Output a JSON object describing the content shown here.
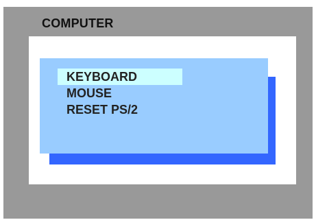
{
  "screen": {
    "title": "COMPUTER"
  },
  "menu": {
    "items": [
      {
        "label": "KEYBOARD",
        "selected": true
      },
      {
        "label": "MOUSE",
        "selected": false
      },
      {
        "label": "RESET PS/2",
        "selected": false
      }
    ]
  },
  "colors": {
    "frame": "#999999",
    "content_background": "#ffffff",
    "menu_background": "#99ccff",
    "menu_shadow": "#3366ff",
    "selection_highlight": "#ccffff",
    "text": "#222222"
  }
}
